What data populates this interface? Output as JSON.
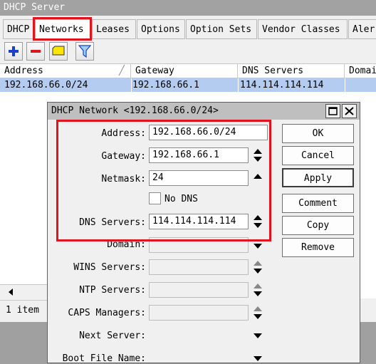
{
  "window": {
    "title": "DHCP Server"
  },
  "tabs": [
    {
      "label": "DHCP"
    },
    {
      "label": "Networks"
    },
    {
      "label": "Leases"
    },
    {
      "label": "Options"
    },
    {
      "label": "Option Sets"
    },
    {
      "label": "Vendor Classes"
    },
    {
      "label": "Aler"
    }
  ],
  "toolbar": {
    "icons": [
      "plus-icon",
      "minus-icon",
      "comment-icon",
      "filter-icon"
    ]
  },
  "table": {
    "headers": [
      "Address",
      "Gateway",
      "DNS Servers",
      "Domai"
    ],
    "rows": [
      {
        "address": "192.168.66.0/24",
        "gateway": "192.168.66.1",
        "dns": "114.114.114.114"
      }
    ],
    "selected_color": "#b3ccef"
  },
  "status": {
    "count": "1 item"
  },
  "dialog": {
    "title": "DHCP Network <192.168.66.0/24>",
    "fields": {
      "address_label": "Address:",
      "address_value": "192.168.66.0/24",
      "gateway_label": "Gateway:",
      "gateway_value": "192.168.66.1",
      "netmask_label": "Netmask:",
      "netmask_value": "24",
      "nodns_label": "No DNS",
      "dns_label": "DNS Servers:",
      "dns_value": "114.114.114.114",
      "domain_label": "Domain:",
      "wins_label": "WINS Servers:",
      "ntp_label": "NTP Servers:",
      "caps_label": "CAPS Managers:",
      "nextserver_label": "Next Server:",
      "bootfile_label": "Boot File Name:"
    },
    "buttons": {
      "ok": "OK",
      "cancel": "Cancel",
      "apply": "Apply",
      "comment": "Comment",
      "copy": "Copy",
      "remove": "Remove"
    }
  },
  "colors": {
    "highlight": "#e0141e",
    "accent": "#1a3fcf"
  }
}
